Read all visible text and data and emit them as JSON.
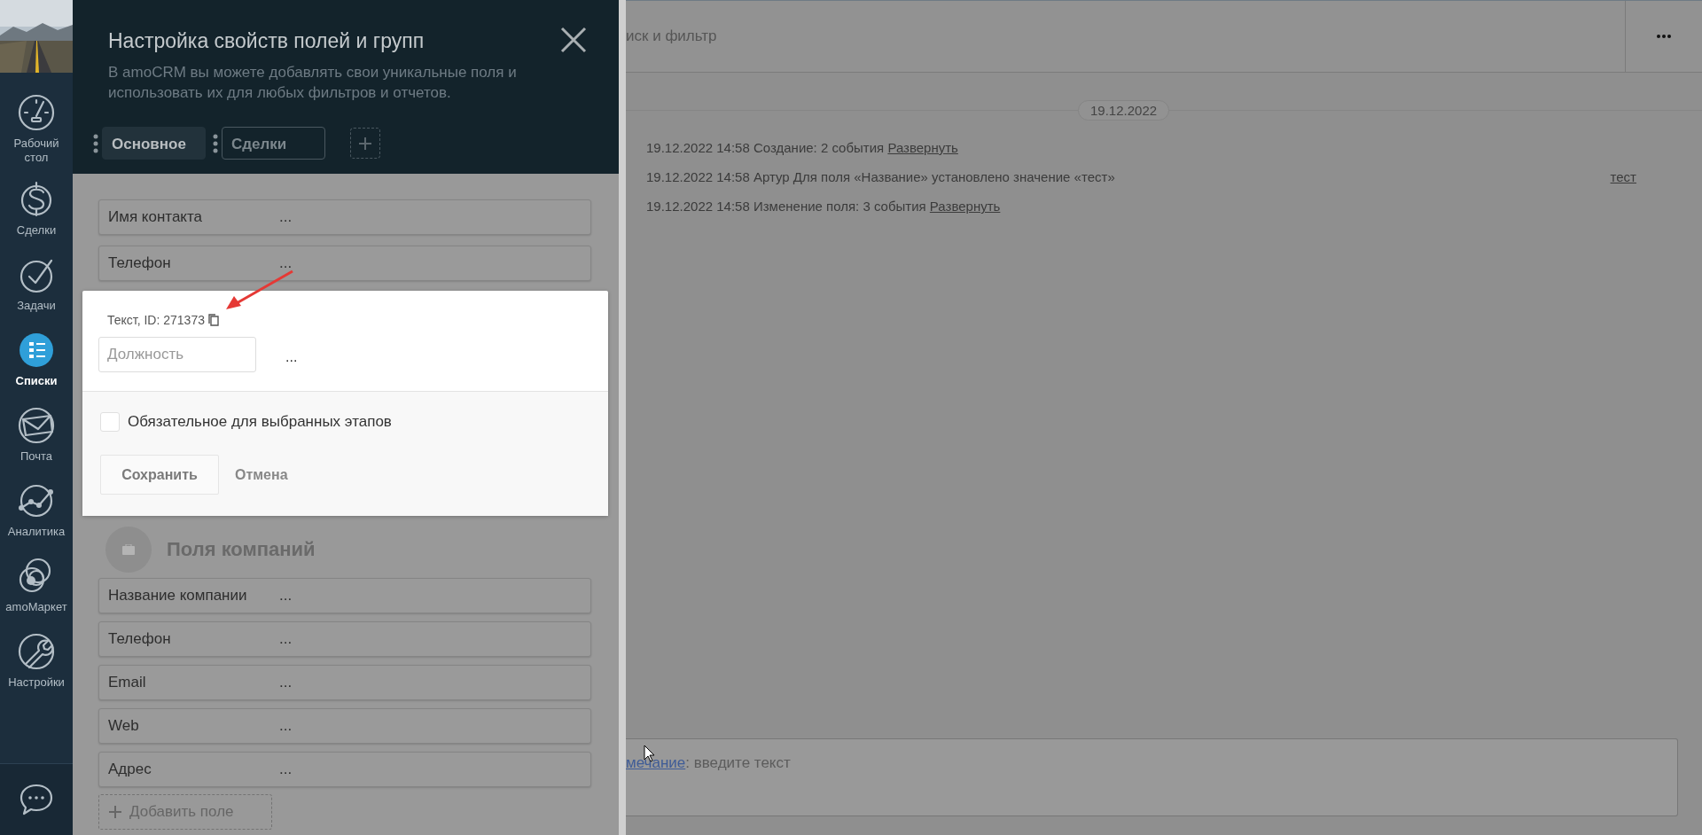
{
  "sidebar": {
    "items": [
      {
        "label": "Рабочий стол",
        "selected": false
      },
      {
        "label": "Сделки",
        "selected": false
      },
      {
        "label": "Задачи",
        "selected": false
      },
      {
        "label": "Списки",
        "selected": true
      },
      {
        "label": "Почта",
        "selected": false
      },
      {
        "label": "Аналитика",
        "selected": false
      },
      {
        "label": "amoМаркет",
        "selected": false
      },
      {
        "label": "Настройки",
        "selected": false
      }
    ]
  },
  "panel": {
    "title": "Настройка свойств полей и групп",
    "subtitle": "В amoCRM вы можете добавлять свои уникальные поля и использовать их для любых фильтров и отчетов.",
    "tabs": [
      {
        "label": "Основное",
        "selected": true
      },
      {
        "label": "Сделки",
        "selected": false
      }
    ],
    "contact_fields": [
      {
        "label": "Имя контакта",
        "menu": "..."
      },
      {
        "label": "Телефон",
        "menu": "..."
      }
    ],
    "edit_popup": {
      "field_type": "Текст, ID: 271373",
      "name_placeholder": "Должность",
      "menu": "...",
      "required": {
        "label": "Обязательное для выбранных этапов",
        "checked": false
      },
      "buttons": [
        "Сохранить",
        "Отмена"
      ]
    },
    "company_section": {
      "title": "Поля компаний",
      "fields": [
        {
          "label": "Название компании",
          "menu": "..."
        },
        {
          "label": "Телефон",
          "menu": "..."
        },
        {
          "label": "Email",
          "menu": "..."
        },
        {
          "label": "Web",
          "menu": "..."
        },
        {
          "label": "Адрес",
          "menu": "..."
        }
      ]
    },
    "add_field": "Добавить поле"
  },
  "main": {
    "search": "иск и фильтр",
    "date": "19.12.2022",
    "events": [
      {
        "text": "19.12.2022 14:58 Создание: 2 события",
        "link": "Развернуть"
      },
      {
        "text": "19.12.2022 14:58 Артур Для поля «Название» установлено значение «тест»",
        "side_link": "тест"
      },
      {
        "text": "19.12.2022 14:58 Изменение поля: 3 события",
        "link": "Развернуть"
      }
    ],
    "note": {
      "link": "мечание",
      "hint": ": введите текст"
    }
  }
}
